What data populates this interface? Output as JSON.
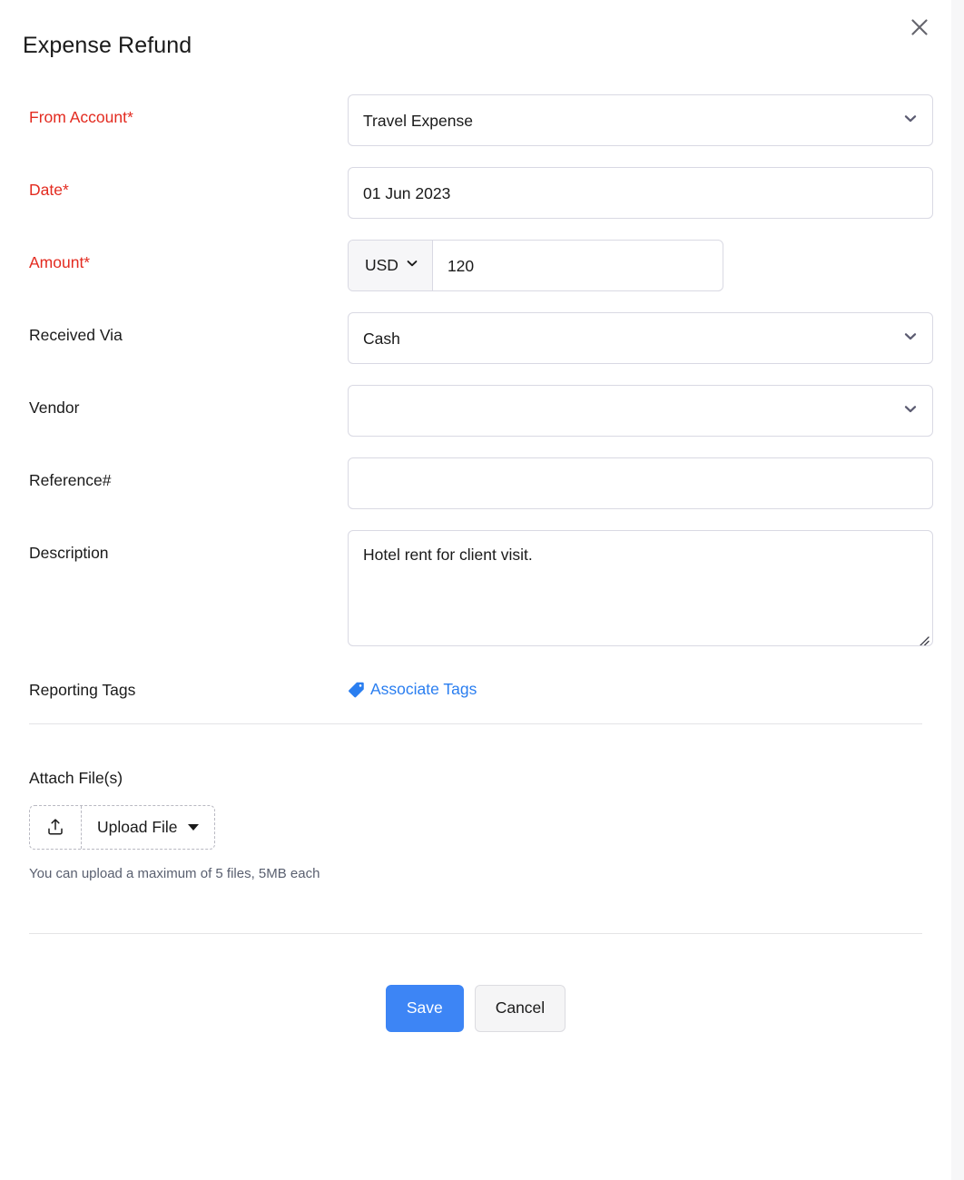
{
  "dialog": {
    "title": "Expense Refund",
    "close_icon": "close-icon"
  },
  "form": {
    "from_account": {
      "label": "From Account*",
      "value": "Travel Expense",
      "required": true,
      "type": "select",
      "chevron_icon": "chevron-down-icon"
    },
    "date": {
      "label": "Date*",
      "value": "01 Jun 2023",
      "required": true,
      "type": "text"
    },
    "amount": {
      "label": "Amount*",
      "currency": "USD",
      "value": "120",
      "required": true,
      "type": "currency",
      "chevron_icon": "chevron-down-icon"
    },
    "received_via": {
      "label": "Received Via",
      "value": "Cash",
      "required": false,
      "type": "select",
      "chevron_icon": "chevron-down-icon"
    },
    "vendor": {
      "label": "Vendor",
      "value": "",
      "required": false,
      "type": "select",
      "chevron_icon": "chevron-down-icon"
    },
    "reference": {
      "label": "Reference#",
      "value": "",
      "required": false,
      "type": "text"
    },
    "description": {
      "label": "Description",
      "value": "Hotel rent for client visit.",
      "required": false,
      "type": "textarea"
    },
    "reporting_tags": {
      "label": "Reporting Tags",
      "link_label": "Associate Tags",
      "link_icon": "tag-icon"
    }
  },
  "attachments": {
    "label": "Attach File(s)",
    "upload_icon": "upload-icon",
    "upload_button_label": "Upload File",
    "dropdown_icon": "caret-down-icon",
    "hint": "You can upload a maximum of 5 files, 5MB each"
  },
  "footer": {
    "save_label": "Save",
    "cancel_label": "Cancel"
  },
  "colors": {
    "required_label": "#e32b20",
    "link_blue": "#2a7ef0",
    "primary_button": "#3d85f5",
    "field_border": "#d9d9e3",
    "hint_text": "#5a6070"
  }
}
